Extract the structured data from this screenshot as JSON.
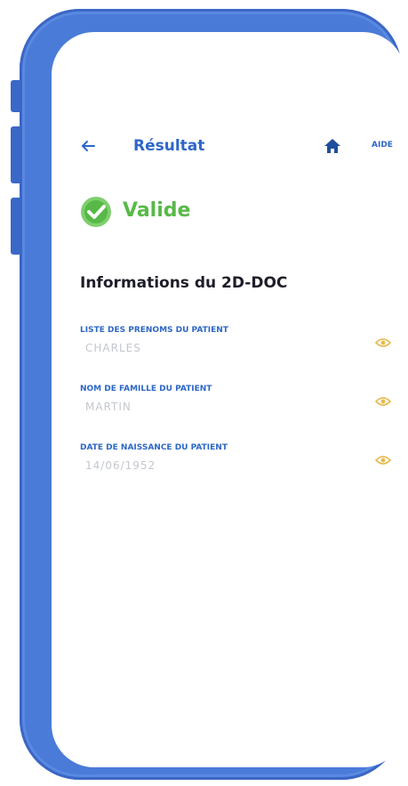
{
  "header": {
    "title": "Résultat",
    "help_label": "AIDE"
  },
  "status": {
    "label": "Valide",
    "color": "#57b947"
  },
  "section": {
    "title": "Informations du 2D-DOC"
  },
  "fields": [
    {
      "label": "LISTE DES PRENOMS DU PATIENT",
      "value": "CHARLES"
    },
    {
      "label": "NOM DE FAMILLE DU PATIENT",
      "value": "MARTIN"
    },
    {
      "label": "DATE DE NAISSANCE DU PATIENT",
      "value": "14/06/1952"
    }
  ],
  "colors": {
    "phone_frame": "#4a7bd8",
    "accent": "#2d67c6",
    "eye_icon": "#e8b94c"
  },
  "icons": {
    "back": "arrow-left-icon",
    "home": "home-icon",
    "status": "check-circle-icon",
    "reveal": "eye-icon"
  }
}
